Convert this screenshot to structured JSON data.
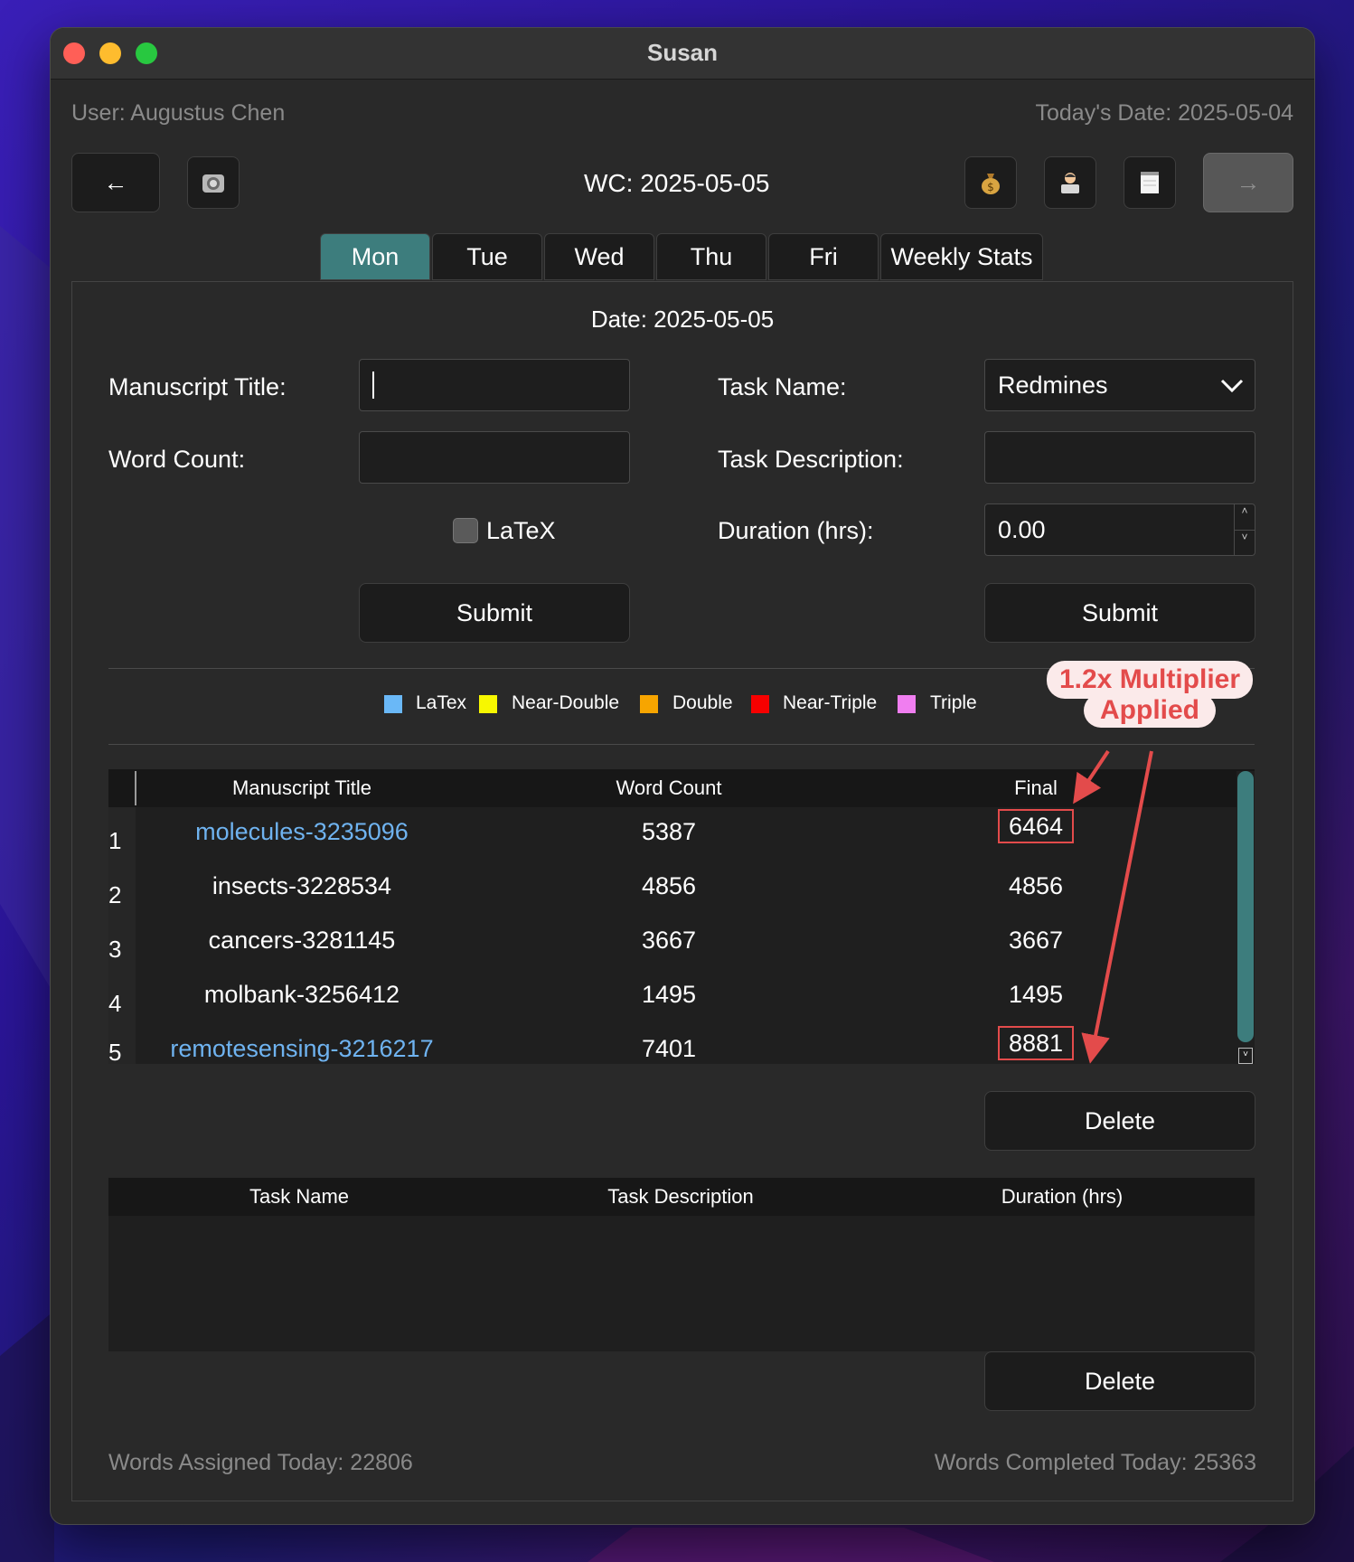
{
  "window": {
    "title": "Susan"
  },
  "header": {
    "user": "User: Augustus Chen",
    "today": "Today's Date: 2025-05-04",
    "week": "WC: 2025-05-05",
    "back_icon": "←",
    "forward_icon": "→"
  },
  "tabs": [
    {
      "label": "Mon",
      "active": true
    },
    {
      "label": "Tue"
    },
    {
      "label": "Wed"
    },
    {
      "label": "Thu"
    },
    {
      "label": "Fri"
    },
    {
      "label": "Weekly Stats"
    }
  ],
  "form": {
    "date": "Date: 2025-05-05",
    "manuscript_title_label": "Manuscript Title:",
    "manuscript_title_value": "",
    "word_count_label": "Word Count:",
    "word_count_value": "",
    "latex_label": "LaTeX",
    "submit_label": "Submit",
    "task_name_label": "Task Name:",
    "task_name_value": "Redmines",
    "task_desc_label": "Task Description:",
    "task_desc_value": "",
    "duration_label": "Duration (hrs):",
    "duration_value": "0.00",
    "task_submit_label": "Submit"
  },
  "legend": [
    {
      "label": "LaTex",
      "color": "#6ab8f7"
    },
    {
      "label": "Near-Double",
      "color": "#f7f700"
    },
    {
      "label": "Double",
      "color": "#f7a500"
    },
    {
      "label": "Near-Triple",
      "color": "#f70000"
    },
    {
      "label": "Triple",
      "color": "#f07ef0"
    }
  ],
  "manuscripts": {
    "headers": [
      "Manuscript Title",
      "Word Count",
      "Final"
    ],
    "rows": [
      {
        "num": "1",
        "title": "molecules-3235096",
        "words": "5387",
        "final": "6464",
        "latex": true
      },
      {
        "num": "2",
        "title": "insects-3228534",
        "words": "4856",
        "final": "4856",
        "latex": false
      },
      {
        "num": "3",
        "title": "cancers-3281145",
        "words": "3667",
        "final": "3667",
        "latex": false
      },
      {
        "num": "4",
        "title": "molbank-3256412",
        "words": "1495",
        "final": "1495",
        "latex": false
      },
      {
        "num": "5",
        "title": "remotesensing-3216217",
        "words": "7401",
        "final": "8881",
        "latex": true
      }
    ],
    "delete_label": "Delete"
  },
  "tasks": {
    "headers": [
      "Task Name",
      "Task Description",
      "Duration (hrs)"
    ],
    "rows": [],
    "delete_label": "Delete"
  },
  "annotation": {
    "line1": "1.2x Multiplier",
    "line2": "Applied",
    "color": "#e34b4b"
  },
  "footer": {
    "assigned": "Words Assigned Today: 22806",
    "completed": "Words Completed Today: 25363"
  }
}
